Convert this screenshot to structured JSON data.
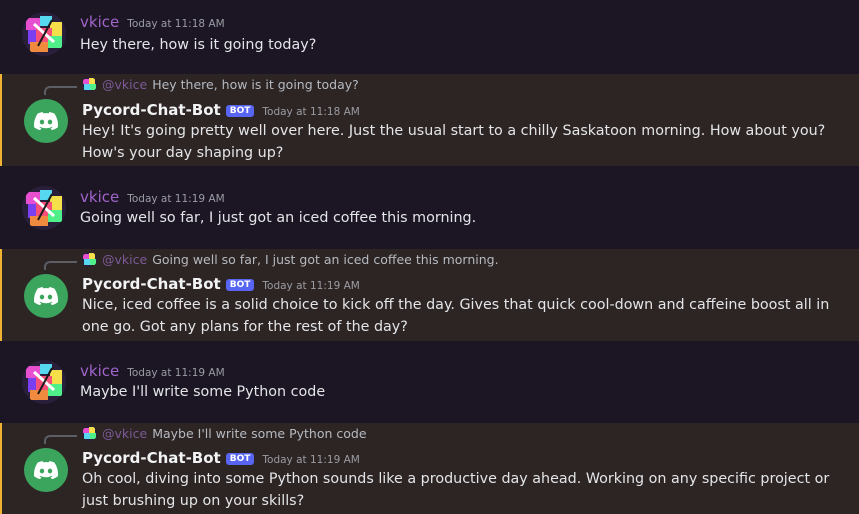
{
  "colors": {
    "background": "#1c1624",
    "bot_row_background": "#2d2424",
    "bot_row_accent": "#f0b232",
    "user_name": "#a064c9",
    "bot_tag": "#5865f2",
    "bot_avatar": "#3ba55d"
  },
  "bot_tag_label": "BOT",
  "messages": [
    {
      "author": "vkice",
      "timestamp": "Today at 11:18 AM",
      "text": "Hey there, how is it going today?"
    },
    {
      "reply_mention": "@vkice",
      "reply_text": "Hey there, how is it going today?",
      "author": "Pycord-Chat-Bot",
      "timestamp": "Today at 11:18 AM",
      "text": "Hey! It's going pretty well over here. Just the usual start to a chilly Saskatoon morning. How about you? How's your day shaping up?"
    },
    {
      "author": "vkice",
      "timestamp": "Today at 11:19 AM",
      "text": "Going well so far, I just got an iced coffee this morning."
    },
    {
      "reply_mention": "@vkice",
      "reply_text": "Going well so far, I just got an iced coffee this morning.",
      "author": "Pycord-Chat-Bot",
      "timestamp": "Today at 11:19 AM",
      "text": "Nice, iced coffee is a solid choice to kick off the day. Gives that quick cool-down and caffeine boost all in one go. Got any plans for the rest of the day?"
    },
    {
      "author": "vkice",
      "timestamp": "Today at 11:19 AM",
      "text": "Maybe I'll write some Python code"
    },
    {
      "reply_mention": "@vkice",
      "reply_text": "Maybe I'll write some Python code",
      "author": "Pycord-Chat-Bot",
      "timestamp": "Today at 11:19 AM",
      "text": "Oh cool, diving into some Python sounds like a productive day ahead. Working on any specific project or just brushing up on your skills?"
    }
  ]
}
